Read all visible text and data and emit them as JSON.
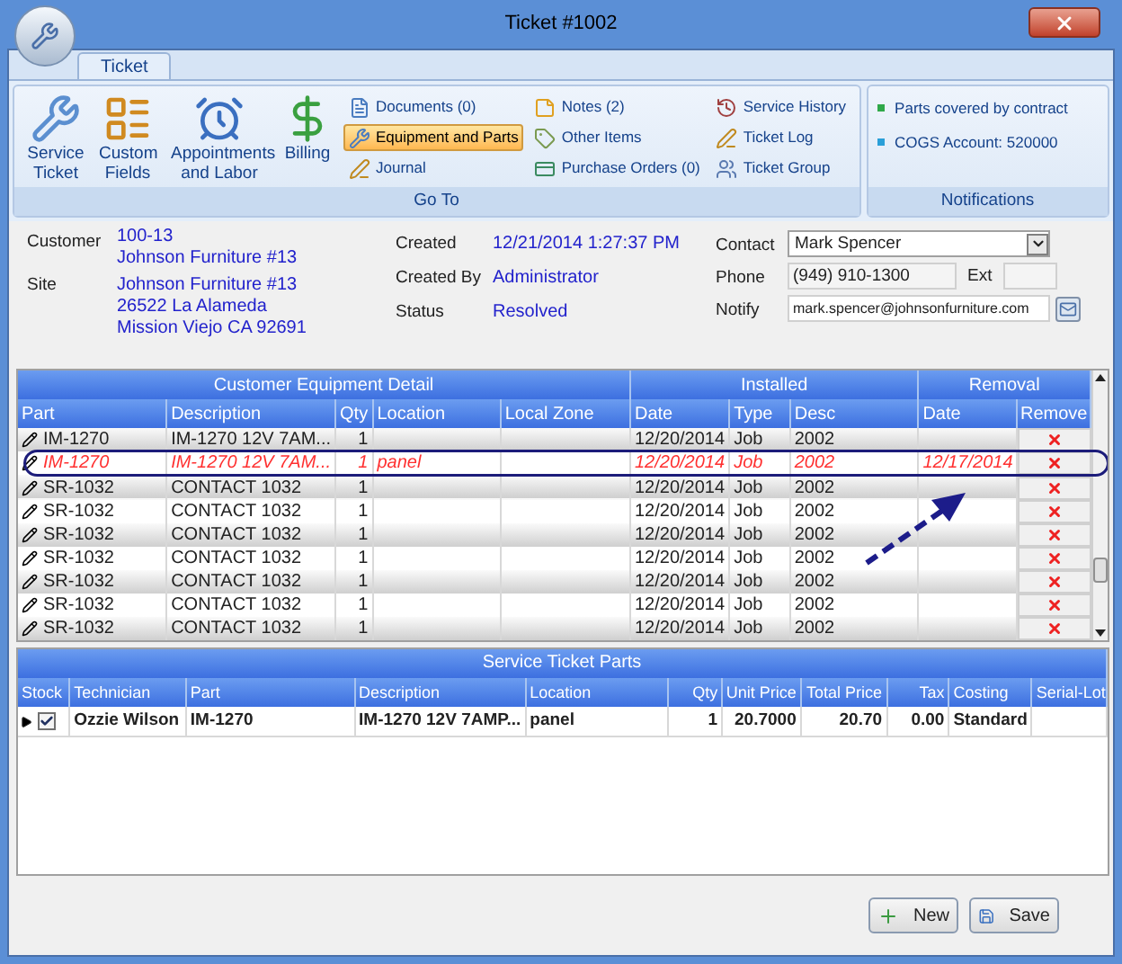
{
  "window": {
    "title": "Ticket #1002"
  },
  "tabs": [
    {
      "label": "Ticket",
      "selected": true
    }
  ],
  "ribbon": {
    "goto": {
      "label": "Go To",
      "large_buttons": [
        {
          "label": "Service Ticket",
          "kind": "wrench"
        },
        {
          "label": "Custom Fields",
          "kind": "form"
        },
        {
          "label": "Appointments and Labor",
          "kind": "clock"
        },
        {
          "label": "Billing",
          "kind": "dollar"
        }
      ],
      "small_columns": [
        [
          {
            "label": "Documents (0)",
            "kind": "document",
            "selected": false
          },
          {
            "label": "Equipment and Parts",
            "kind": "equipment",
            "selected": true
          },
          {
            "label": "Journal",
            "kind": "pencil",
            "selected": false
          }
        ],
        [
          {
            "label": "Notes (2)",
            "kind": "note",
            "selected": false
          },
          {
            "label": "Other Items",
            "kind": "tag",
            "selected": false
          },
          {
            "label": "Purchase Orders (0)",
            "kind": "card",
            "selected": false
          }
        ],
        [
          {
            "label": "Service History",
            "kind": "history",
            "selected": false
          },
          {
            "label": "Ticket Log",
            "kind": "pencil",
            "selected": false
          },
          {
            "label": "Ticket Group",
            "kind": "group",
            "selected": false
          }
        ]
      ]
    },
    "notifications": {
      "label": "Notifications",
      "items": [
        {
          "label": "Parts covered by contract",
          "color": "#2fa84a"
        },
        {
          "label": "COGS Account: 520000",
          "color": "#2a9fd8"
        }
      ]
    }
  },
  "info": {
    "customer_label": "Customer",
    "customer_id": "100-13",
    "customer_name": "Johnson Furniture #13",
    "site_label": "Site",
    "site_lines": [
      "Johnson Furniture #13",
      "26522 La Alameda",
      "Mission Viejo CA 92691"
    ],
    "created_label": "Created",
    "created": "12/21/2014 1:27:37 PM",
    "created_by_label": "Created By",
    "created_by": "Administrator",
    "status_label": "Status",
    "status": "Resolved",
    "contact_label": "Contact",
    "contact": "Mark Spencer",
    "phone_label": "Phone",
    "phone": "(949) 910-1300",
    "ext_label": "Ext",
    "notify_label": "Notify",
    "notify": "mark.spencer@johnsonfurniture.com"
  },
  "equipment": {
    "group_headers": [
      "Customer Equipment Detail",
      "Installed",
      "Removal"
    ],
    "columns": [
      "Part",
      "Description",
      "Qty",
      "Location",
      "Local Zone",
      "Date",
      "Type",
      "Desc",
      "Date",
      "Remove"
    ],
    "rows": [
      {
        "part": "IM-1270",
        "description": "IM-1270  12V  7AM...",
        "qty": "1",
        "location": "",
        "install_date": "12/20/2014",
        "type": "Job",
        "desc": "2002",
        "removal_date": "",
        "removed": false
      },
      {
        "part": "IM-1270",
        "description": "IM-1270  12V  7AM...",
        "qty": "1",
        "location": "panel",
        "install_date": "12/20/2014",
        "type": "Job",
        "desc": "2002",
        "removal_date": "12/17/2014",
        "removed": true
      },
      {
        "part": "SR-1032",
        "description": "CONTACT 1032",
        "qty": "1",
        "location": "",
        "install_date": "12/20/2014",
        "type": "Job",
        "desc": "2002",
        "removal_date": "",
        "removed": false
      },
      {
        "part": "SR-1032",
        "description": "CONTACT 1032",
        "qty": "1",
        "location": "",
        "install_date": "12/20/2014",
        "type": "Job",
        "desc": "2002",
        "removal_date": "",
        "removed": false
      },
      {
        "part": "SR-1032",
        "description": "CONTACT 1032",
        "qty": "1",
        "location": "",
        "install_date": "12/20/2014",
        "type": "Job",
        "desc": "2002",
        "removal_date": "",
        "removed": false
      },
      {
        "part": "SR-1032",
        "description": "CONTACT 1032",
        "qty": "1",
        "location": "",
        "install_date": "12/20/2014",
        "type": "Job",
        "desc": "2002",
        "removal_date": "",
        "removed": false
      },
      {
        "part": "SR-1032",
        "description": "CONTACT 1032",
        "qty": "1",
        "location": "",
        "install_date": "12/20/2014",
        "type": "Job",
        "desc": "2002",
        "removal_date": "",
        "removed": false
      },
      {
        "part": "SR-1032",
        "description": "CONTACT 1032",
        "qty": "1",
        "location": "",
        "install_date": "12/20/2014",
        "type": "Job",
        "desc": "2002",
        "removal_date": "",
        "removed": false
      },
      {
        "part": "SR-1032",
        "description": "CONTACT 1032",
        "qty": "1",
        "location": "",
        "install_date": "12/20/2014",
        "type": "Job",
        "desc": "2002",
        "removal_date": "",
        "removed": false
      }
    ]
  },
  "service_parts": {
    "title": "Service Ticket Parts",
    "columns": [
      "Stock",
      "Technician",
      "Part",
      "Description",
      "Location",
      "Qty",
      "Unit Price",
      "Total Price",
      "Tax",
      "Costing",
      "Serial-Lot"
    ],
    "rows": [
      {
        "checked": true,
        "technician": "Ozzie Wilson",
        "part": "IM-1270",
        "description": "IM-1270 12V 7AMP...",
        "location": "panel",
        "qty": "1",
        "unit_price": "20.7000",
        "total_price": "20.70",
        "tax": "0.00",
        "costing": "Standard",
        "serial_lot": ""
      }
    ]
  },
  "buttons": [
    {
      "label": "New",
      "kind": "new"
    },
    {
      "label": "Save",
      "kind": "save"
    }
  ]
}
